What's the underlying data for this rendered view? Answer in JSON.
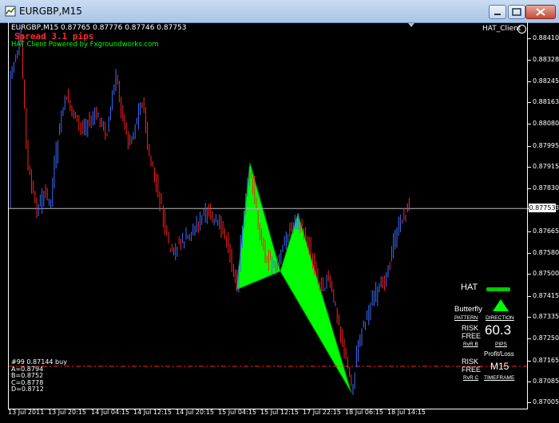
{
  "window": {
    "title": "EURGBP,M15"
  },
  "header": {
    "symbol_line": "EURGBP,M15  0.87765 0.87776 0.87746 0.87753",
    "spread": "Spread 3.1 pips",
    "powered_by": "HAT Client Powered by Fxgroundworks.com",
    "indicator_name": "HAT_Client"
  },
  "price_axis": {
    "labels": [
      "0.88410",
      "0.88328",
      "0.88245",
      "0.88163",
      "0.88080",
      "0.87995",
      "0.87915",
      "0.87830",
      "0.87753",
      "0.87665",
      "0.87580",
      "0.87500",
      "0.87415",
      "0.87335",
      "0.87250",
      "0.87165",
      "0.87085",
      "0.87005"
    ],
    "current_price": "0.87753"
  },
  "time_axis": {
    "labels": [
      "13 Jul 2011",
      "13 Jul 20:15",
      "14 Jul 04:15",
      "14 Jul 12:15",
      "14 Jul 20:15",
      "15 Jul 04:15",
      "15 Jul 12:15",
      "17 Jul 22:15",
      "18 Jul 06:15",
      "18 Jul 14:15"
    ]
  },
  "hat_panel": {
    "title": "HAT",
    "pattern_value": "Butterfly",
    "pattern_label": "PATTERN",
    "direction_label": "DIRECTION",
    "risk_free_1": [
      "RISK",
      "FREE"
    ],
    "rvr_b_label": "RvR B",
    "pips_value": "60.3",
    "pips_label": "PIPS",
    "profit_loss_label": "Profit/Loss",
    "risk_free_2": [
      "RISK",
      "FREE"
    ],
    "rvr_c_label": "RvR C",
    "timeframe_value": "M15",
    "timeframe_label": "TIMEFRAME",
    "colors": {
      "accent": "#00cc00",
      "link": "#3fa0ff"
    }
  },
  "trade_info": {
    "order_line": "#99 0.87144 buy",
    "points": [
      "A=0.8794",
      "B=0.8752",
      "C=0.8778",
      "D=0.8712"
    ]
  },
  "colors": {
    "bull": "#3b6cff",
    "bear": "#ff2020",
    "pattern_fill": "#00ff00",
    "order_line": "#ff2020",
    "price_line": "#bbbbbb"
  }
}
